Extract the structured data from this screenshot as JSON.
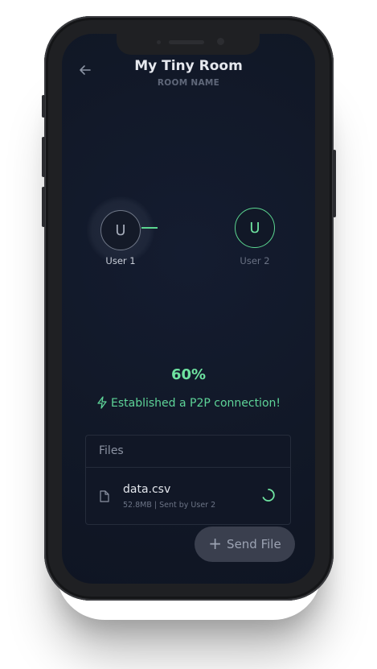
{
  "header": {
    "title": "My Tiny Room",
    "subtitle": "ROOM NAME",
    "back_icon": "arrow-left-icon"
  },
  "users": [
    {
      "initial": "U",
      "name": "User 1",
      "active": true
    },
    {
      "initial": "U",
      "name": "User 2",
      "active": false
    }
  ],
  "progress": {
    "percent_label": "60%",
    "status_text": "Established a P2P connection!",
    "status_icon": "lightning-icon"
  },
  "files": {
    "header": "Files",
    "items": [
      {
        "name": "data.csv",
        "meta": "52.8MB | Sent by User 2",
        "icon": "file-icon",
        "state_icon": "loading-spinner-icon"
      }
    ]
  },
  "send_button": {
    "label": "Send File",
    "icon": "plus-icon"
  },
  "colors": {
    "accent": "#6ee3a0",
    "background": "#111827",
    "panel": "#111726",
    "button": "#3a3f4e"
  }
}
